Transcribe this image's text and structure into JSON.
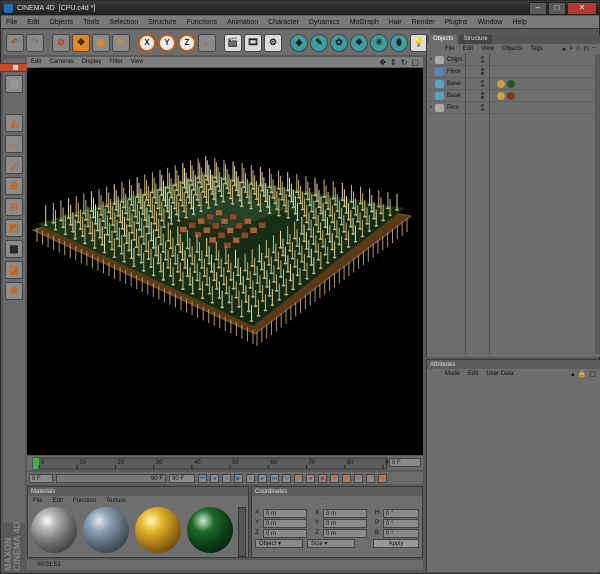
{
  "window": {
    "app": "CINEMA 4D",
    "document": "[CPU.c4d *]"
  },
  "menu": [
    "File",
    "Edit",
    "Objects",
    "Tools",
    "Selection",
    "Structure",
    "Functions",
    "Animation",
    "Character",
    "Dynamics",
    "MoGraph",
    "Hair",
    "Render",
    "Plugins",
    "Window",
    "Help"
  ],
  "toolbar": {
    "axis_x": "X",
    "axis_y": "Y",
    "axis_z": "Z"
  },
  "viewport": {
    "menu": [
      "Edit",
      "Cameras",
      "Display",
      "Filter",
      "View"
    ]
  },
  "timeline": {
    "ticks": [
      "0",
      "10",
      "20",
      "30",
      "40",
      "50",
      "60",
      "70",
      "80",
      "90"
    ],
    "current_frame": "0 F",
    "start_field": "0 F",
    "end_field": "90 F",
    "range_end": "90 F"
  },
  "objects_panel": {
    "tabs": [
      "Objects",
      "Structure"
    ],
    "menu": [
      "File",
      "Edit",
      "View",
      "Objects",
      "Tags"
    ],
    "items": [
      {
        "name": "Chips",
        "expander": "+",
        "icon_color": "#a8a8a8",
        "tags": [
          "#6b6b6b"
        ]
      },
      {
        "name": "Floor",
        "expander": "",
        "icon_color": "#5a86c4",
        "tags": []
      },
      {
        "name": "Base",
        "expander": "",
        "icon_color": "#4fa6c8",
        "tags": [
          "#c9a24a",
          "#1c5a23"
        ]
      },
      {
        "name": "Base",
        "expander": "",
        "icon_color": "#4fa6c8",
        "tags": [
          "#c9a24a",
          "#7a3c1a"
        ]
      },
      {
        "name": "Pins",
        "expander": "+",
        "icon_color": "#a8a8a8",
        "tags": []
      }
    ]
  },
  "attributes_panel": {
    "title": "Attributes",
    "menu": [
      "Mode",
      "Edit",
      "User Data"
    ]
  },
  "materials_panel": {
    "title": "Materials",
    "menu": [
      "File",
      "Edit",
      "Function",
      "Texture"
    ]
  },
  "coordinates_panel": {
    "title": "Coordinates",
    "rows": [
      {
        "axis": "X",
        "pos": "0 m",
        "size": "0 m",
        "rot_label": "H",
        "rot": "0 °"
      },
      {
        "axis": "Y",
        "pos": "0 m",
        "size": "0 m",
        "rot_label": "P",
        "rot": "0 °"
      },
      {
        "axis": "Z",
        "pos": "0 m",
        "size": "0 m",
        "rot_label": "B",
        "rot": "0 °"
      }
    ],
    "mode_select": "Object",
    "size_select": "Size",
    "apply_label": "Apply"
  },
  "status": {
    "time": "00:01:53"
  },
  "brand": "MAXON CINEMA 4D"
}
